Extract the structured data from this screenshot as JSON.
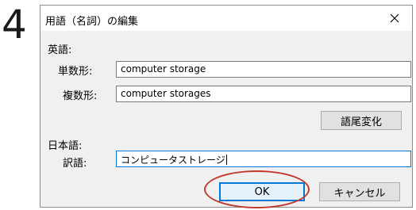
{
  "step_number": "4",
  "dialog": {
    "title": "用語（名詞）の編集",
    "close_label": "×"
  },
  "english": {
    "section_label": "英語:",
    "singular_label": "単数形:",
    "singular_value": "computer storage",
    "plural_label": "複数形:",
    "plural_value": "computer storages",
    "inflection_button": "語尾変化"
  },
  "japanese": {
    "section_label": "日本語:",
    "translation_label": "訳語:",
    "translation_value": "コンピュータストレージ"
  },
  "buttons": {
    "ok": "OK",
    "cancel": "キャンセル"
  },
  "colors": {
    "highlight_oval": "#c0392b",
    "focus_border": "#0078d7"
  }
}
